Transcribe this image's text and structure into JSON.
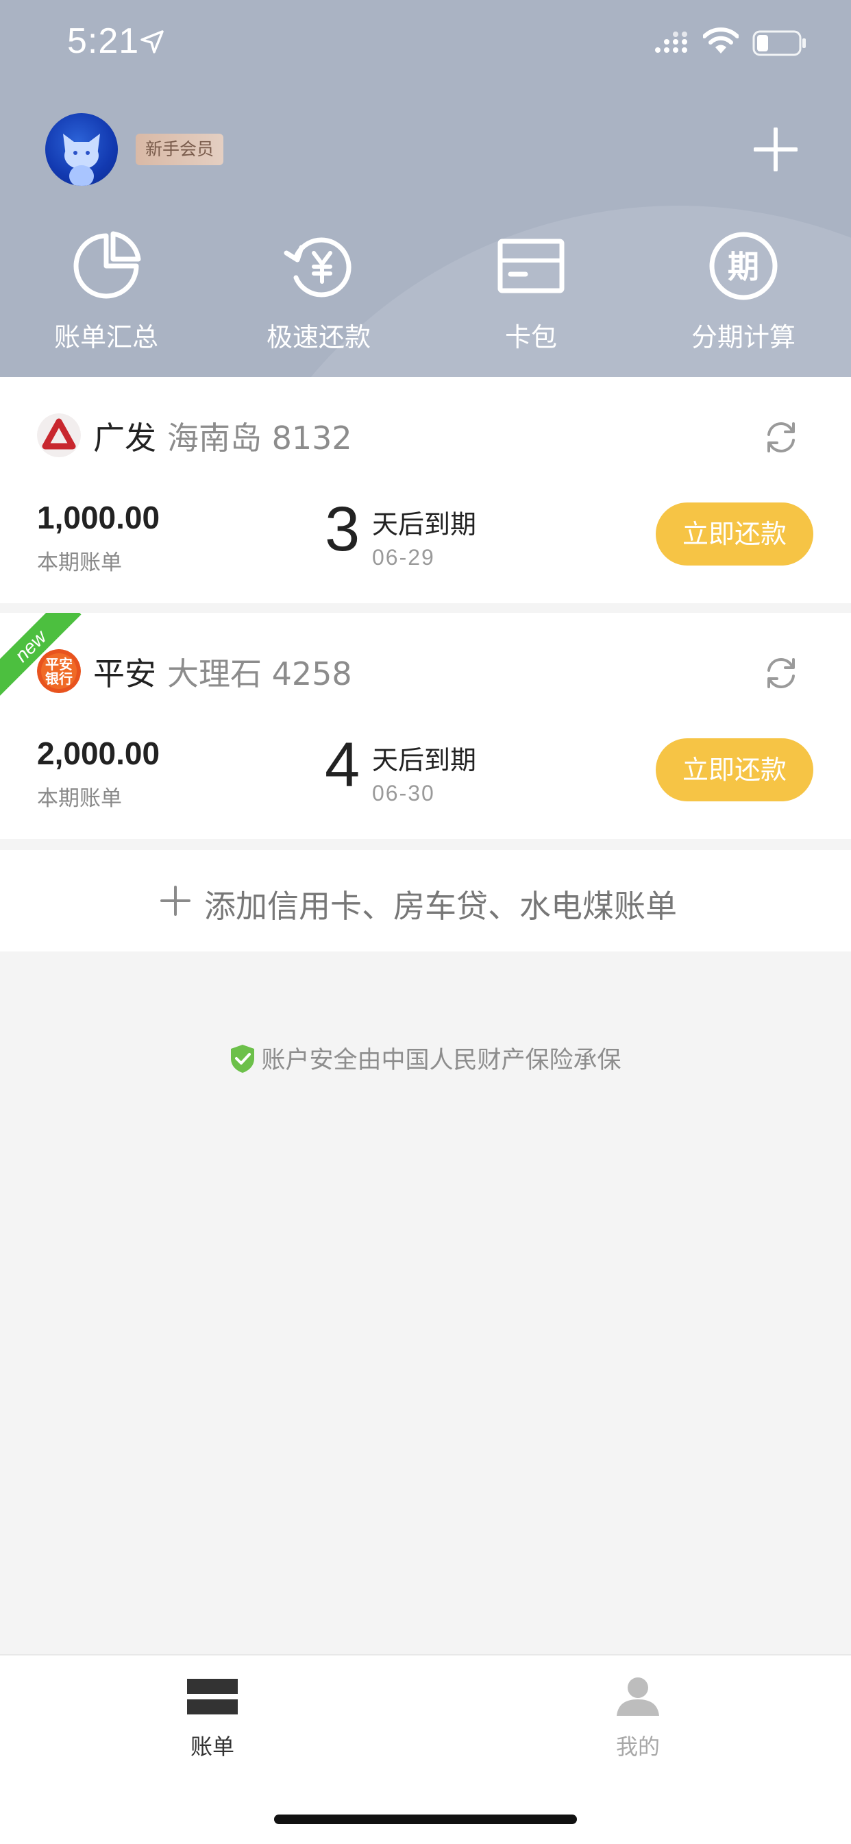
{
  "status_bar": {
    "time": "5:21"
  },
  "header": {
    "member_badge": "新手会员",
    "quick_actions": [
      {
        "label": "账单汇总",
        "icon": "pie-chart-icon"
      },
      {
        "label": "极速还款",
        "icon": "yuan-refresh-icon"
      },
      {
        "label": "卡包",
        "icon": "card-icon"
      },
      {
        "label": "分期计算",
        "icon": "installment-icon"
      }
    ]
  },
  "cards": [
    {
      "bank": "广发",
      "card": "海南岛 8132",
      "amount": "1,000.00",
      "amount_label": "本期账单",
      "days": "3",
      "due_text": "天后到期",
      "due_date": "06-29",
      "pay_label": "立即还款",
      "is_new": false
    },
    {
      "bank": "平安",
      "card": "大理石 4258",
      "amount": "2,000.00",
      "amount_label": "本期账单",
      "days": "4",
      "due_text": "天后到期",
      "due_date": "06-30",
      "pay_label": "立即还款",
      "is_new": true,
      "new_label": "new",
      "logo_text": "平安\n银行"
    }
  ],
  "add_bill": {
    "label": "添加信用卡、房车贷、水电煤账单"
  },
  "safety_note": "账户安全由中国人民财产保险承保",
  "tabbar": {
    "items": [
      {
        "label": "账单",
        "active": true
      },
      {
        "label": "我的",
        "active": false
      }
    ]
  },
  "colors": {
    "header_bg": "#aab3c3",
    "accent": "#f6c445",
    "new_ribbon": "#4cbf3f",
    "shield": "#6cc04a"
  }
}
